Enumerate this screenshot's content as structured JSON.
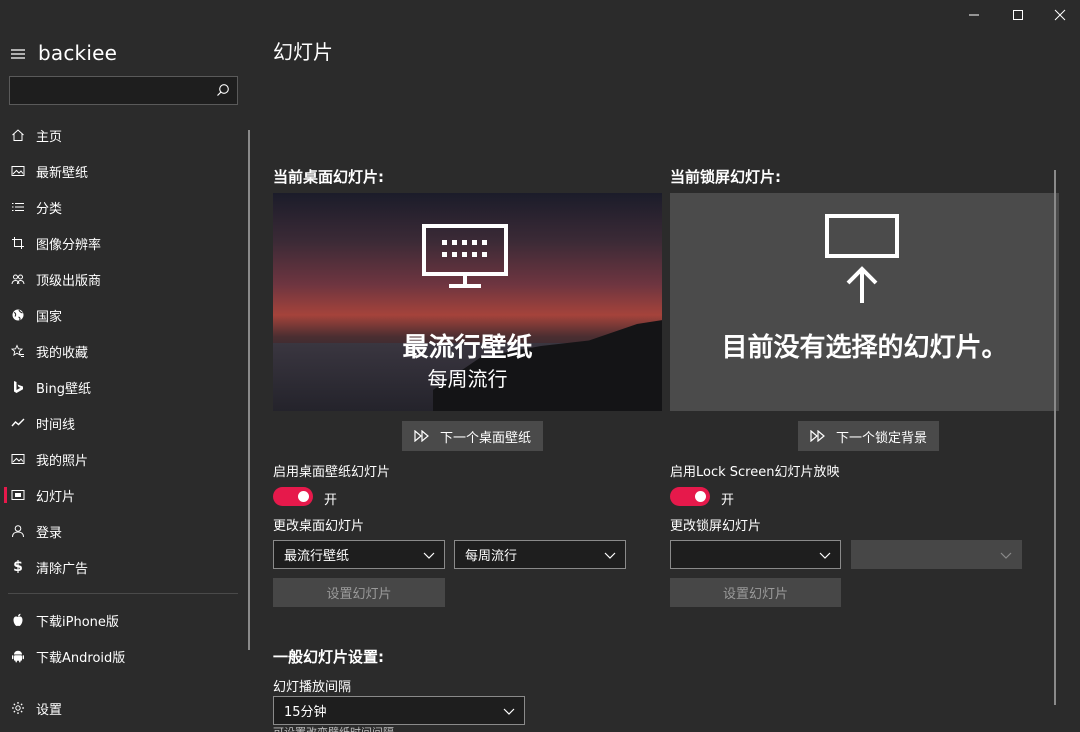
{
  "app": {
    "name": "backiee"
  },
  "search": {
    "placeholder": "",
    "value": ""
  },
  "nav": {
    "items": [
      {
        "label": "主页",
        "icon": "home-icon"
      },
      {
        "label": "最新壁纸",
        "icon": "image-icon"
      },
      {
        "label": "分类",
        "icon": "list-icon"
      },
      {
        "label": "图像分辨率",
        "icon": "crop-icon"
      },
      {
        "label": "顶级出版商",
        "icon": "people-icon"
      },
      {
        "label": "国家",
        "icon": "globe-icon"
      },
      {
        "label": "我的收藏",
        "icon": "favorites-icon"
      },
      {
        "label": "Bing壁纸",
        "icon": "bing-icon"
      },
      {
        "label": "时间线",
        "icon": "timeline-icon"
      },
      {
        "label": "我的照片",
        "icon": "photo-icon"
      },
      {
        "label": "幻灯片",
        "icon": "slideshow-icon",
        "active": true
      },
      {
        "label": "登录",
        "icon": "user-icon"
      },
      {
        "label": "清除广告",
        "icon": "dollar-icon"
      }
    ],
    "downloads": [
      {
        "label": "下载iPhone版",
        "icon": "apple-icon"
      },
      {
        "label": "下载Android版",
        "icon": "android-icon"
      }
    ],
    "settings": {
      "label": "设置",
      "icon": "gear-icon"
    }
  },
  "page": {
    "title": "幻灯片"
  },
  "desktop": {
    "section_title": "当前桌面幻灯片:",
    "preview_title": "最流行壁纸",
    "preview_subtitle": "每周流行",
    "next_button": "下一个桌面壁纸",
    "enable_label": "启用桌面壁纸幻灯片",
    "toggle_state": "开",
    "change_label": "更改桌面幻灯片",
    "select_source": "最流行壁纸",
    "select_period": "每周流行",
    "set_button": "设置幻灯片"
  },
  "lock": {
    "section_title": "当前锁屏幻灯片:",
    "preview_message": "目前没有选择的幻灯片。",
    "next_button": "下一个锁定背景",
    "enable_label": "启用Lock Screen幻灯片放映",
    "toggle_state": "开",
    "change_label": "更改锁屏幻灯片",
    "select_source": "",
    "select_period": "",
    "set_button": "设置幻灯片"
  },
  "general": {
    "section_title": "一般幻灯片设置:",
    "interval_label": "幻灯播放间隔",
    "interval_value": "15分钟",
    "hint": "可设置改变壁纸时间间隔"
  },
  "colors": {
    "accent": "#e6194b",
    "background": "#2b2b2b"
  }
}
